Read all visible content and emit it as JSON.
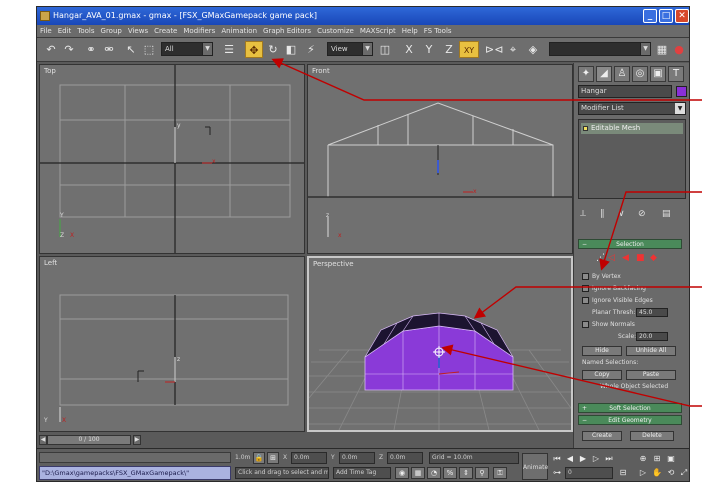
{
  "window": {
    "title": "Hangar_AVA_01.gmax - gmax - [FSX_GMaxGamepack game pack]",
    "minimize_icon": "minimize-icon",
    "maximize_icon": "maximize-icon",
    "close_icon": "close-icon"
  },
  "menu": [
    "File",
    "Edit",
    "Tools",
    "Group",
    "Views",
    "Create",
    "Modifiers",
    "Animation",
    "Graph Editors",
    "Customize",
    "MAXScript",
    "Help",
    "FS Tools"
  ],
  "toolbar": {
    "selection_filter": "All",
    "reference_coord": "View",
    "axis_x": "X",
    "axis_y": "Y",
    "axis_z": "Z",
    "axis_xy": "XY",
    "active_tool": "select-and-move-icon"
  },
  "viewports": {
    "top": {
      "label": "Top"
    },
    "front": {
      "label": "Front"
    },
    "left": {
      "label": "Left"
    },
    "perspective": {
      "label": "Perspective"
    }
  },
  "command_panel": {
    "object_name": "Hangar",
    "object_color": "#8a2fd8",
    "modifier_list": "Modifier List",
    "stack_item": "Editable Mesh",
    "selection_rollout": "Selection",
    "by_vertex": "By Vertex",
    "ignore_backfacing": "Ignore Backfacing",
    "ignore_visible_edges": "Ignore Visible Edges",
    "planar_thresh_label": "Planar Thresh:",
    "planar_thresh_value": "45.0",
    "show_normals": "Show Normals",
    "scale_label": "Scale:",
    "scale_value": "20.0",
    "hide": "Hide",
    "unhide_all": "Unhide All",
    "named_selections": "Named Selections:",
    "copy": "Copy",
    "paste": "Paste",
    "whole_object_selected": "Whole Object Selected",
    "soft_selection_rollout": "Soft Selection",
    "edit_geometry_rollout": "Edit Geometry",
    "create": "Create",
    "delete": "Delete"
  },
  "timeline": {
    "frame": "0 / 100"
  },
  "status": {
    "path": "\"D:\\Gmax\\gamepacks\\FSX_GMaxGamepack\\\"",
    "units": "1.0m",
    "x_label": "X",
    "x_value": "0.0m",
    "y_label": "Y",
    "y_value": "0.0m",
    "z_label": "Z",
    "z_value": "0.0m",
    "grid": "Grid = 10.0m",
    "prompt": "Click and drag to select and m",
    "add_time_tag": "Add Time Tag",
    "animate": "Animate",
    "current_frame": "0"
  },
  "colors": {
    "annotation": "#c00000",
    "selection_fill": "#8a3ad8",
    "roof_dark": "#1c1430",
    "rollout": "#4a8a5a"
  }
}
